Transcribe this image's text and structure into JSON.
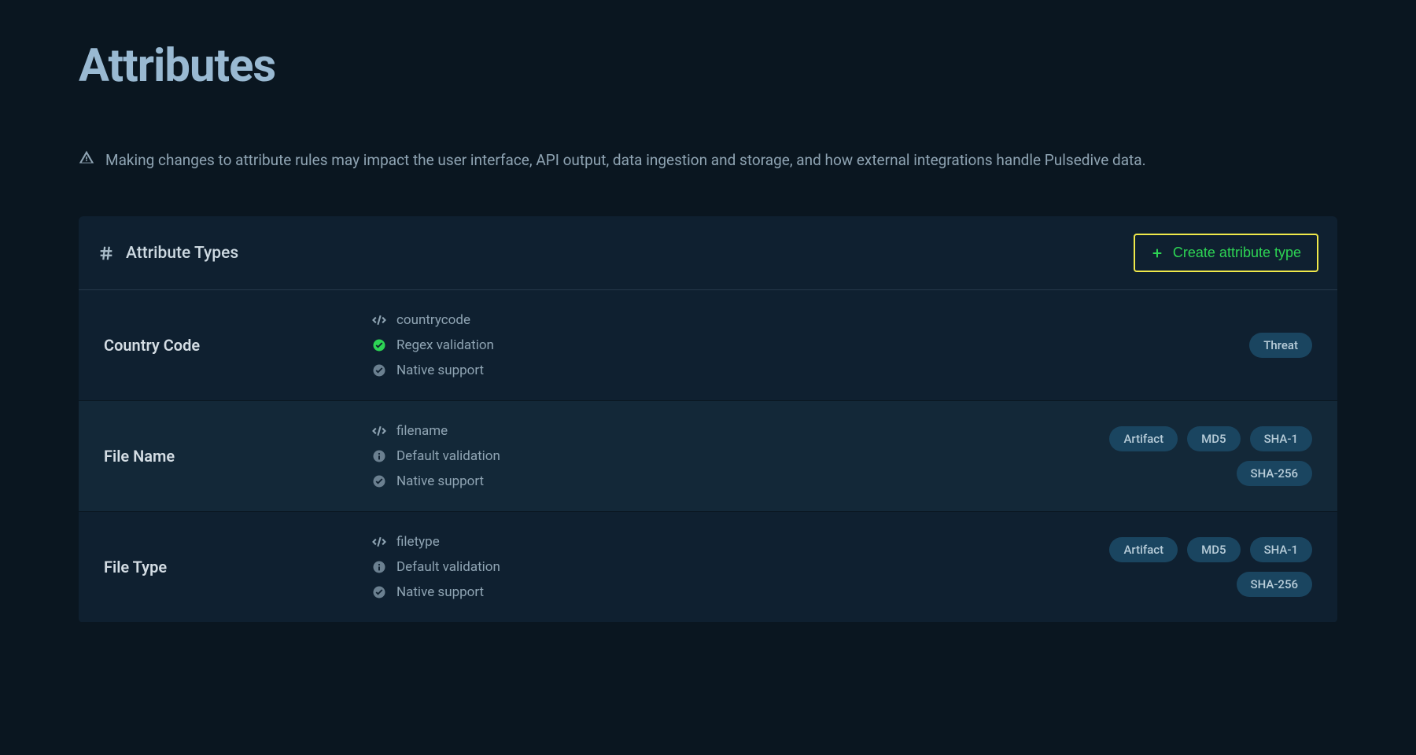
{
  "page": {
    "title": "Attributes",
    "warning": "Making changes to attribute rules may impact the user interface, API output, data ingestion and storage, and how external integrations handle Pulsedive data."
  },
  "section": {
    "title": "Attribute Types",
    "create_label": "Create attribute type"
  },
  "types": [
    {
      "name": "Country Code",
      "slug": "countrycode",
      "validation": "Regex validation",
      "validation_kind": "regex",
      "support": "Native support",
      "tags": [
        "Threat"
      ]
    },
    {
      "name": "File Name",
      "slug": "filename",
      "validation": "Default validation",
      "validation_kind": "default",
      "support": "Native support",
      "tags": [
        "Artifact",
        "MD5",
        "SHA-1",
        "SHA-256"
      ]
    },
    {
      "name": "File Type",
      "slug": "filetype",
      "validation": "Default validation",
      "validation_kind": "default",
      "support": "Native support",
      "tags": [
        "Artifact",
        "MD5",
        "SHA-1",
        "SHA-256"
      ]
    }
  ]
}
